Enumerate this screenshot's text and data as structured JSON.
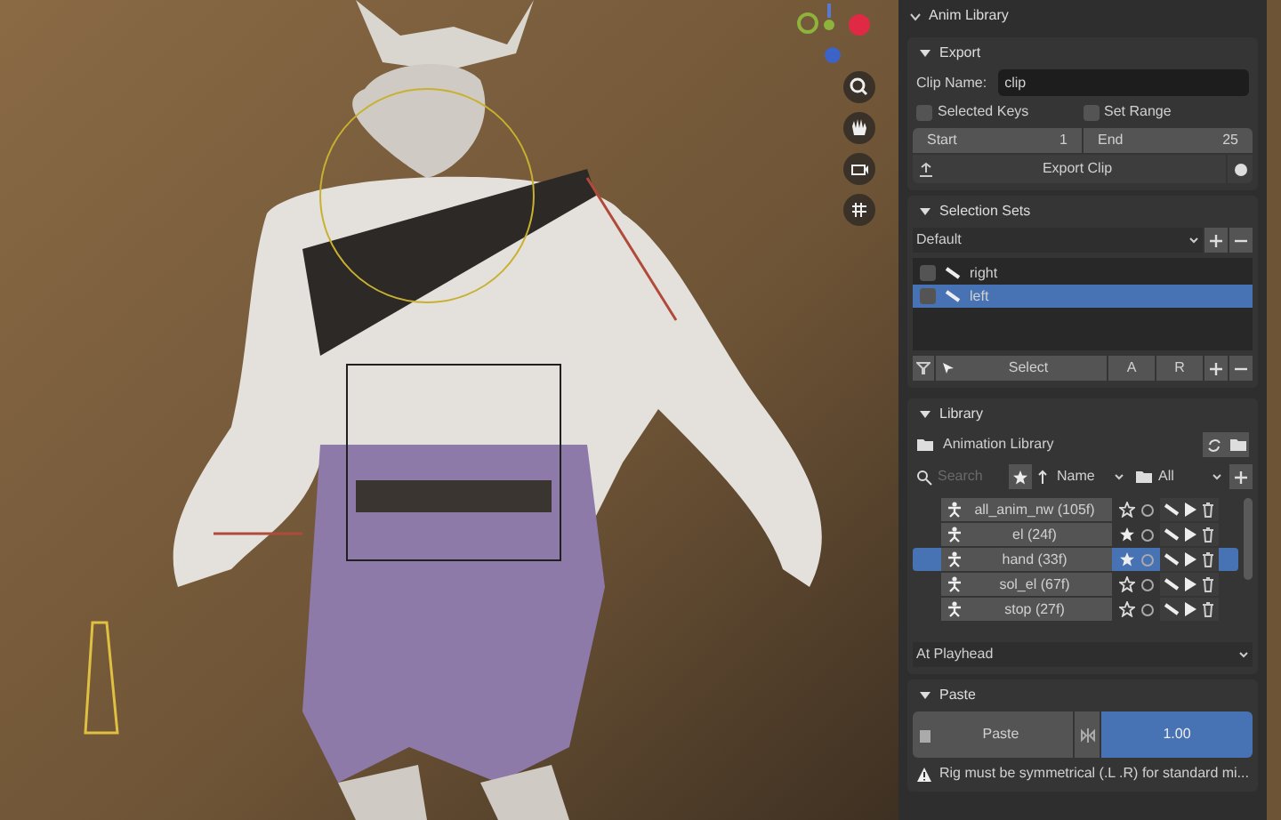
{
  "panel": {
    "title": "Anim Library"
  },
  "export": {
    "title": "Export",
    "expanded": true,
    "clip_name_label": "Clip Name:",
    "clip_name": "clip",
    "options": [
      {
        "label": "Selected Keys",
        "checked": false
      },
      {
        "label": "Set Range",
        "checked": false
      }
    ],
    "start_label": "Start",
    "start": "1",
    "end_label": "End",
    "end": "25",
    "button": "Export Clip"
  },
  "selection_sets": {
    "title": "Selection Sets",
    "expanded": true,
    "dropdown": "Default",
    "items": [
      {
        "label": "right",
        "checked": false,
        "selected": false
      },
      {
        "label": "left",
        "checked": false,
        "selected": true
      }
    ],
    "select_button": "Select",
    "a_button": "A",
    "r_button": "R"
  },
  "library": {
    "title": "Library",
    "expanded": true,
    "name": "Animation Library",
    "search_placeholder": "Search",
    "sort": "Name",
    "filter": "All",
    "clips": [
      {
        "label": "all_anim_nw (105f)",
        "favorite": false,
        "selected": false
      },
      {
        "label": "el (24f)",
        "favorite": true,
        "selected": false
      },
      {
        "label": "hand (33f)",
        "favorite": true,
        "selected": true
      },
      {
        "label": "sol_el (67f)",
        "favorite": false,
        "selected": false
      },
      {
        "label": "stop (27f)",
        "favorite": false,
        "selected": false
      }
    ],
    "insert_mode": "At Playhead"
  },
  "paste": {
    "title": "Paste",
    "expanded": true,
    "button": "Paste",
    "value": "1.00"
  },
  "warning": "Rig must be symmetrical (.L .R) for standard mi..."
}
